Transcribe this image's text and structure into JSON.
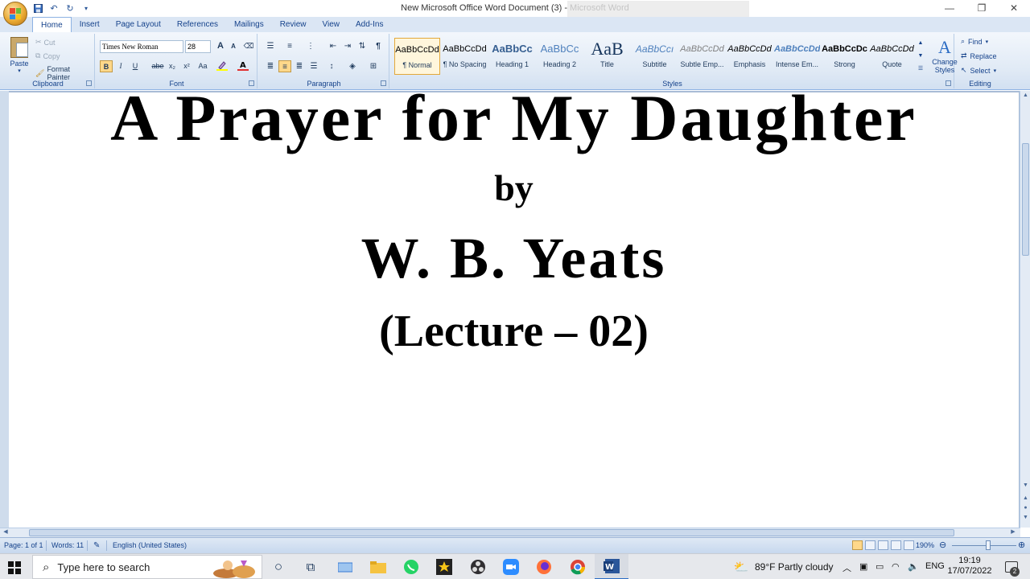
{
  "window": {
    "title": "New Microsoft Office Word Document (3) - Microsoft Word",
    "controls": {
      "minimize": "—",
      "restore": "❐",
      "close": "✕"
    }
  },
  "tabs": [
    "Home",
    "Insert",
    "Page Layout",
    "References",
    "Mailings",
    "Review",
    "View",
    "Add-Ins"
  ],
  "ribbon": {
    "clipboard": {
      "paste": "Paste",
      "cut": "Cut",
      "copy": "Copy",
      "format_painter": "Format Painter",
      "label": "Clipboard"
    },
    "font": {
      "name": "Times New Roman",
      "size": "28",
      "bold": "B",
      "italic": "I",
      "underline": "U",
      "strike": "abe",
      "sub": "x₂",
      "sup": "x²",
      "case": "Aa",
      "grow": "A",
      "shrink": "A",
      "label": "Font"
    },
    "paragraph": {
      "label": "Paragraph"
    },
    "styles": {
      "label": "Styles",
      "items": [
        {
          "sample": "AaBbCcDd",
          "name": "¶ Normal"
        },
        {
          "sample": "AaBbCcDd",
          "name": "¶ No Spacing"
        },
        {
          "sample": "AaBbCc",
          "name": "Heading 1"
        },
        {
          "sample": "AaBbCc",
          "name": "Heading 2"
        },
        {
          "sample": "AaB",
          "name": "Title"
        },
        {
          "sample": "AaBbCcı",
          "name": "Subtitle"
        },
        {
          "sample": "AaBbCcDd",
          "name": "Subtle Emp..."
        },
        {
          "sample": "AaBbCcDd",
          "name": "Emphasis"
        },
        {
          "sample": "AaBbCcDd",
          "name": "Intense Em..."
        },
        {
          "sample": "AaBbCcDc",
          "name": "Strong"
        },
        {
          "sample": "AaBbCcDd",
          "name": "Quote"
        }
      ],
      "change_styles_1": "Change",
      "change_styles_2": "Styles"
    },
    "editing": {
      "label": "Editing",
      "find": "Find",
      "replace": "Replace",
      "select": "Select"
    }
  },
  "document": {
    "line1": "A Prayer for My Daughter",
    "line2": "by",
    "line3": "W. B. Yeats",
    "line4": "(Lecture – 02)"
  },
  "status": {
    "page": "Page: 1 of 1",
    "words": "Words: 11",
    "language": "English (United States)",
    "zoom": "190%"
  },
  "taskbar": {
    "search_placeholder": "Type here to search",
    "weather": "89°F  Partly cloudy",
    "lang": "ENG",
    "time": "19:19",
    "date": "17/07/2022",
    "notifications": "2"
  }
}
